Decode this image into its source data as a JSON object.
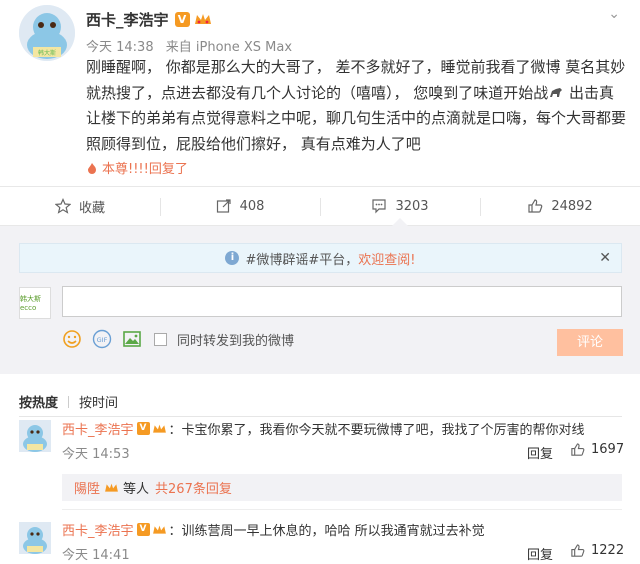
{
  "post": {
    "author": "西卡_李浩宇",
    "verified_badge": "V",
    "time": "今天 14:38",
    "source": "来自 iPhone XS Max",
    "text_before_icon": "刚睡醒啊，   你都是那么大的大哥了，  差不多就好了，睡觉前我看了微博 莫名其妙就热搜了，点进去都没有几个人讨论的（嘻嘻），  您嗅到了味道开始战",
    "text_after_icon": " 出击真让楼下的弟弟有点觉得意料之中呢，聊几句生活中的点滴就是口嗨，每个大哥都要照顾得到位，屁股给他们擦好，  真有点难为人了吧",
    "reply_link": "本尊!!!!回复了",
    "avatar_badge": "韩大斯"
  },
  "actions": {
    "favorite": "收藏",
    "repost_count": "408",
    "comment_count": "3203",
    "like_count": "24892"
  },
  "notice": {
    "prefix": "#微博辟谣#平台，",
    "link": "欢迎查阅!"
  },
  "composer": {
    "avatar_label": "韩大斯ecco",
    "input_value": "",
    "gif_label": "GIF",
    "repost_checkbox_label": "同时转发到我的微博",
    "submit_label": "评论"
  },
  "sort": {
    "hot": "按热度",
    "time": "按时间"
  },
  "comments": [
    {
      "author": "西卡_李浩宇",
      "text": "：卡宝你累了，我看你今天就不要玩微博了吧，我找了个厉害的帮你对线",
      "time": "今天 14:53",
      "reply": "回复",
      "likes": "1697",
      "avatar_badge": "韩大斯"
    },
    {
      "author": "西卡_李浩宇",
      "text": "：训练营周一早上休息的，哈哈  所以我通宵就过去补觉",
      "time": "今天 14:41",
      "reply": "回复",
      "likes": "1222",
      "avatar_badge": "韩大斯"
    }
  ],
  "subreplies": {
    "name": "陽陞",
    "mid": "等人",
    "link": "共267条回复"
  },
  "colors": {
    "accent": "#eb7350",
    "badge": "#f59a23",
    "panel_bg": "#f2f2f5",
    "notice_bg": "#eaf5fb",
    "submit_bg": "#ffc09f"
  }
}
